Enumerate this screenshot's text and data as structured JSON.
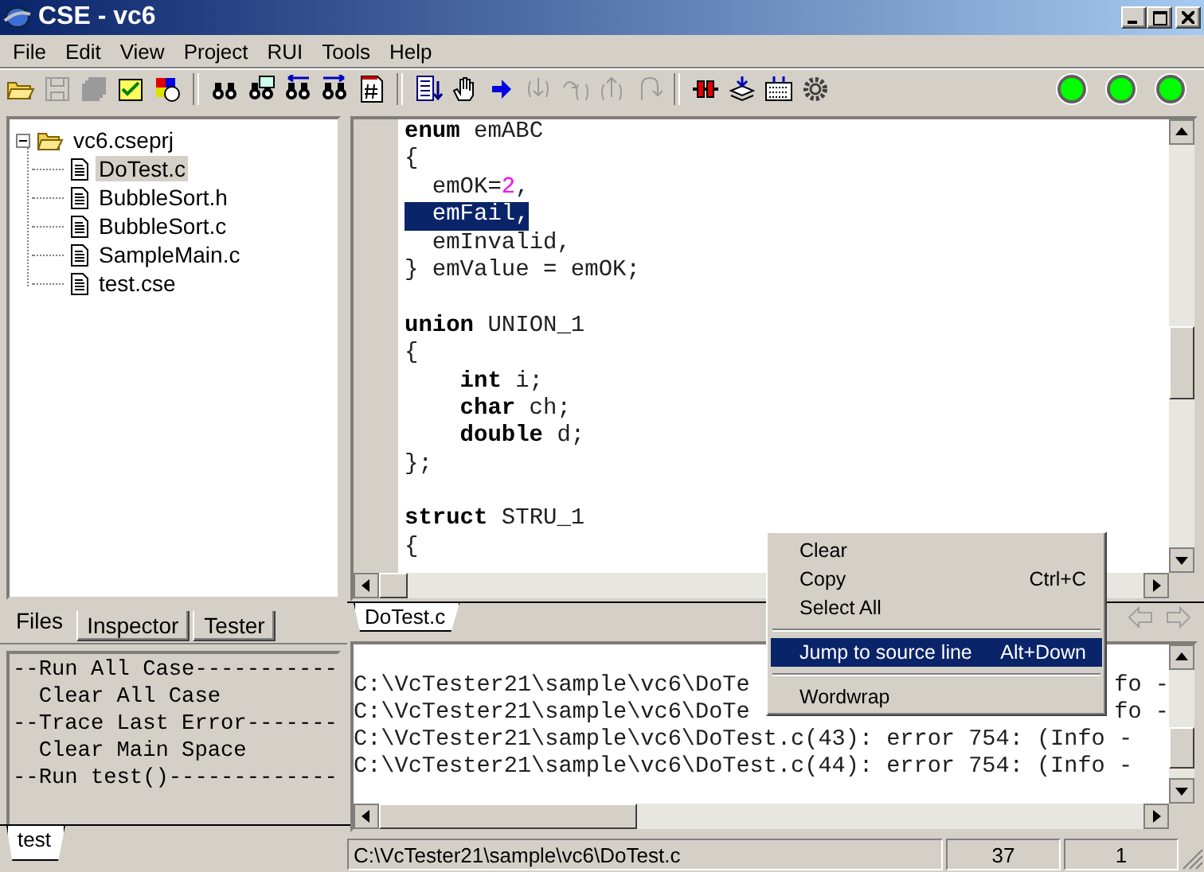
{
  "window": {
    "title": "CSE - vc6"
  },
  "menu": [
    "File",
    "Edit",
    "View",
    "Project",
    "RUI",
    "Tools",
    "Help"
  ],
  "toolbar": [
    {
      "kind": "open",
      "disabled": false
    },
    {
      "kind": "save",
      "disabled": true
    },
    {
      "kind": "save-all",
      "disabled": true
    },
    {
      "kind": "check",
      "disabled": false
    },
    {
      "kind": "palette",
      "disabled": false
    },
    {
      "kind": "sep"
    },
    {
      "kind": "find",
      "disabled": false
    },
    {
      "kind": "find-in-files",
      "disabled": false
    },
    {
      "kind": "find-prev",
      "disabled": false
    },
    {
      "kind": "find-next",
      "disabled": false
    },
    {
      "kind": "hash",
      "disabled": false
    },
    {
      "kind": "sep"
    },
    {
      "kind": "list",
      "disabled": false
    },
    {
      "kind": "hand",
      "disabled": false
    },
    {
      "kind": "arrow",
      "disabled": false
    },
    {
      "kind": "step-into",
      "disabled": true
    },
    {
      "kind": "step-over",
      "disabled": true
    },
    {
      "kind": "step-out",
      "disabled": true
    },
    {
      "kind": "step-back",
      "disabled": true
    },
    {
      "kind": "sep"
    },
    {
      "kind": "break",
      "disabled": false
    },
    {
      "kind": "stack",
      "disabled": false
    },
    {
      "kind": "calendar",
      "disabled": false
    },
    {
      "kind": "gear",
      "disabled": false
    }
  ],
  "status_lights": [
    {
      "color": "#00ff00"
    },
    {
      "color": "#00ff00"
    },
    {
      "color": "#00ff00"
    }
  ],
  "tree": {
    "label": "vc6.cseprj",
    "expanded": true,
    "children": [
      {
        "label": "DoTest.c",
        "selected": true
      },
      {
        "label": "BubbleSort.h",
        "selected": false
      },
      {
        "label": "BubbleSort.c",
        "selected": false
      },
      {
        "label": "SampleMain.c",
        "selected": false
      },
      {
        "label": "test.cse",
        "selected": false
      }
    ]
  },
  "side_tabs": [
    {
      "label": "Files",
      "selected": true
    },
    {
      "label": "Inspector",
      "selected": false
    },
    {
      "label": "Tester",
      "selected": false
    }
  ],
  "commands": [
    "--Run All Case-----------",
    "  Clear All Case",
    "--Trace Last Error-------",
    "  Clear Main Space",
    "--Run test()-------------"
  ],
  "command_tabs": [
    {
      "label": "test",
      "selected": true
    }
  ],
  "editor": {
    "lines": [
      {
        "kind": "code",
        "selected": false,
        "tokens": [
          {
            "text": "enum",
            "kind": "keyword"
          },
          {
            "text": " emABC",
            "kind": "plain"
          }
        ]
      },
      {
        "kind": "code",
        "selected": false,
        "tokens": [
          {
            "text": "{",
            "kind": "plain"
          }
        ]
      },
      {
        "kind": "code",
        "selected": false,
        "tokens": [
          {
            "text": "  emOK=",
            "kind": "plain"
          },
          {
            "text": "2",
            "kind": "number"
          },
          {
            "text": ",",
            "kind": "plain"
          }
        ]
      },
      {
        "kind": "code",
        "selected": true,
        "tokens": [
          {
            "text": "  emFail,",
            "kind": "plain"
          }
        ]
      },
      {
        "kind": "code",
        "selected": false,
        "tokens": [
          {
            "text": "  emInvalid,",
            "kind": "plain"
          }
        ]
      },
      {
        "kind": "code",
        "selected": false,
        "tokens": [
          {
            "text": "} emValue = emOK;",
            "kind": "plain"
          }
        ]
      },
      {
        "kind": "blank"
      },
      {
        "kind": "code",
        "selected": false,
        "tokens": [
          {
            "text": "union",
            "kind": "keyword"
          },
          {
            "text": " UNION_1",
            "kind": "plain"
          }
        ]
      },
      {
        "kind": "code",
        "selected": false,
        "tokens": [
          {
            "text": "{",
            "kind": "plain"
          }
        ]
      },
      {
        "kind": "indented",
        "selected": false,
        "tokens": [
          {
            "text": "int",
            "kind": "keyword"
          },
          {
            "text": " i;",
            "kind": "plain"
          }
        ]
      },
      {
        "kind": "indented",
        "selected": false,
        "tokens": [
          {
            "text": "char",
            "kind": "keyword"
          },
          {
            "text": " ch;",
            "kind": "plain"
          }
        ]
      },
      {
        "kind": "indented",
        "selected": false,
        "tokens": [
          {
            "text": "double",
            "kind": "keyword"
          },
          {
            "text": " d;",
            "kind": "plain"
          }
        ]
      },
      {
        "kind": "code",
        "selected": false,
        "tokens": [
          {
            "text": "};",
            "kind": "plain"
          }
        ]
      },
      {
        "kind": "blank"
      },
      {
        "kind": "code",
        "selected": false,
        "tokens": [
          {
            "text": "struct",
            "kind": "keyword"
          },
          {
            "text": " STRU_1",
            "kind": "plain"
          }
        ]
      },
      {
        "kind": "code",
        "selected": false,
        "tokens": [
          {
            "text": "{",
            "kind": "plain"
          }
        ]
      }
    ]
  },
  "editor_tabs": [
    {
      "label": "DoTest.c",
      "selected": true
    }
  ],
  "output": {
    "lines": [
      {
        "start": "C:\\VcTester21\\sample\\vc6\\DoTe",
        "end": "fo -"
      },
      {
        "start": "C:\\VcTester21\\sample\\vc6\\DoTe",
        "end": "fo -"
      },
      {
        "start": "C:\\VcTester21\\sample\\vc6\\DoTest.c(43): error 754: (Info -"
      },
      {
        "start": "C:\\VcTester21\\sample\\vc6\\DoTest.c(44): error 754: (Info -"
      }
    ]
  },
  "context_menu": {
    "items": [
      {
        "kind": "item",
        "label": "Clear",
        "selected": false
      },
      {
        "kind": "item",
        "label": "Copy",
        "shortcut": "Ctrl+C",
        "selected": false
      },
      {
        "kind": "item",
        "label": "Select All",
        "selected": false
      },
      {
        "kind": "separator"
      },
      {
        "kind": "item",
        "label": "Jump to source line",
        "shortcut": "Alt+Down",
        "selected": true
      },
      {
        "kind": "separator"
      },
      {
        "kind": "item",
        "label": "Wordwrap",
        "selected": false
      }
    ]
  },
  "status_bar": {
    "path": "C:\\VcTester21\\sample\\vc6\\DoTest.c",
    "line": "37",
    "column": "1"
  }
}
